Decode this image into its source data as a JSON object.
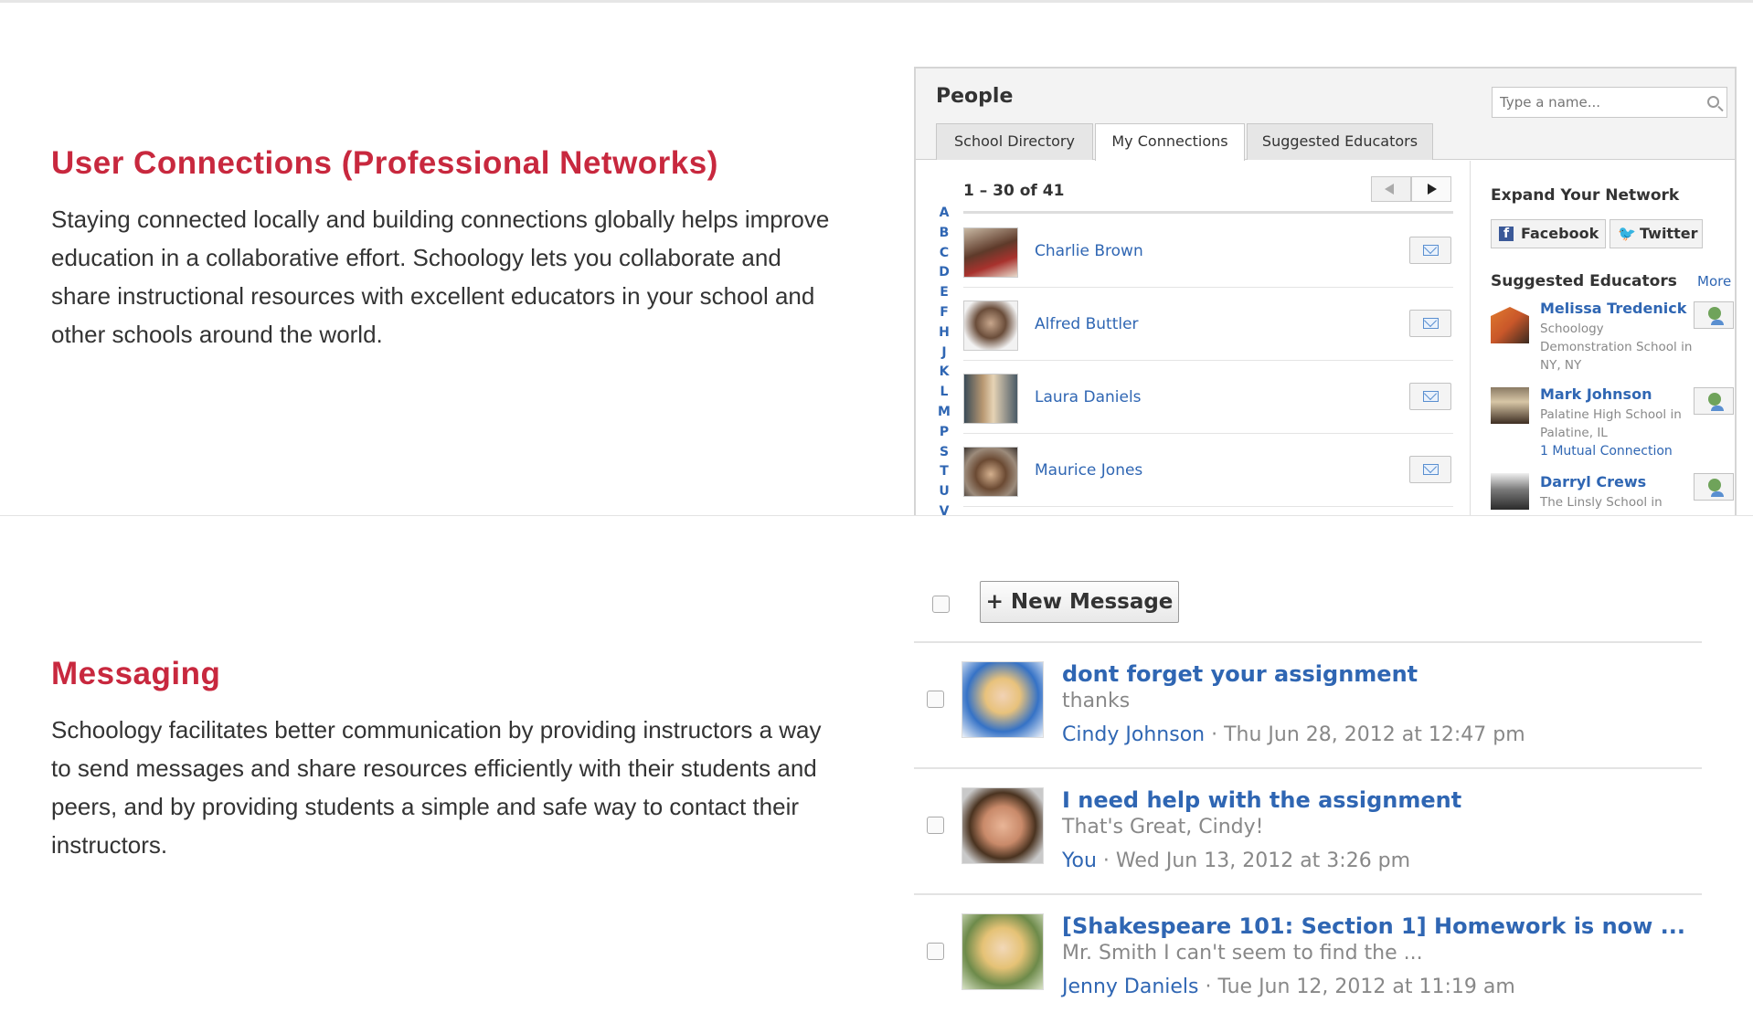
{
  "sections": {
    "connections": {
      "title": "User Connections (Professional Networks)",
      "description": "Staying connected locally and building connections globally helps improve education in a collaborative effort. Schoology lets you collaborate and share instructional resources with excellent educators in your school and other schools around the world."
    },
    "messaging": {
      "title": "Messaging",
      "description": "Schoology facilitates better communication by providing instructors a way to send messages and share resources efficiently with their students and peers, and by providing students a simple and safe way to contact their instructors."
    }
  },
  "people_panel": {
    "title": "People",
    "search_placeholder": "Type a name...",
    "tabs": [
      {
        "label": "School Directory",
        "active": false
      },
      {
        "label": "My Connections",
        "active": true
      },
      {
        "label": "Suggested Educators",
        "active": false
      }
    ],
    "letters": [
      "A",
      "B",
      "C",
      "D",
      "E",
      "F",
      "H",
      "J",
      "K",
      "L",
      "M",
      "P",
      "S",
      "T",
      "U",
      "V"
    ],
    "count_text": "1 – 30 of 41",
    "connections": [
      {
        "name": "Charlie Brown"
      },
      {
        "name": "Alfred Buttler"
      },
      {
        "name": "Laura Daniels"
      },
      {
        "name": "Maurice Jones"
      }
    ],
    "expand_title": "Expand Your Network",
    "facebook_label": "Facebook",
    "twitter_label": "Twitter",
    "suggested_title": "Suggested Educators",
    "more_label": "More",
    "suggested": [
      {
        "name": "Melissa Tredenick",
        "school": "Schoology Demonstration School in NY, NY",
        "mutual": ""
      },
      {
        "name": "Mark Johnson",
        "school": "Palatine High School in Palatine, IL",
        "mutual": "1 Mutual Connection"
      },
      {
        "name": "Darryl Crews",
        "school": "The Linsly School in",
        "mutual": ""
      }
    ]
  },
  "messages_panel": {
    "new_message_label": "+ New Message",
    "messages": [
      {
        "subject": "dont forget your assignment",
        "preview": "thanks",
        "sender": "Cindy Johnson",
        "date": " · Thu Jun 28, 2012 at 12:47 pm"
      },
      {
        "subject": "I need help with the assignment",
        "preview": "That's Great, Cindy!",
        "sender": "You",
        "date": " · Wed Jun 13, 2012 at 3:26 pm"
      },
      {
        "subject": "[Shakespeare 101: Section 1] Homework is now ...",
        "preview": "Mr. Smith I can't seem to find the ...",
        "sender": "Jenny Daniels",
        "date": " · Tue Jun 12, 2012 at 11:19 am"
      }
    ]
  },
  "colors": {
    "heading_red": "#c8283e",
    "link_blue": "#2f66b3"
  }
}
